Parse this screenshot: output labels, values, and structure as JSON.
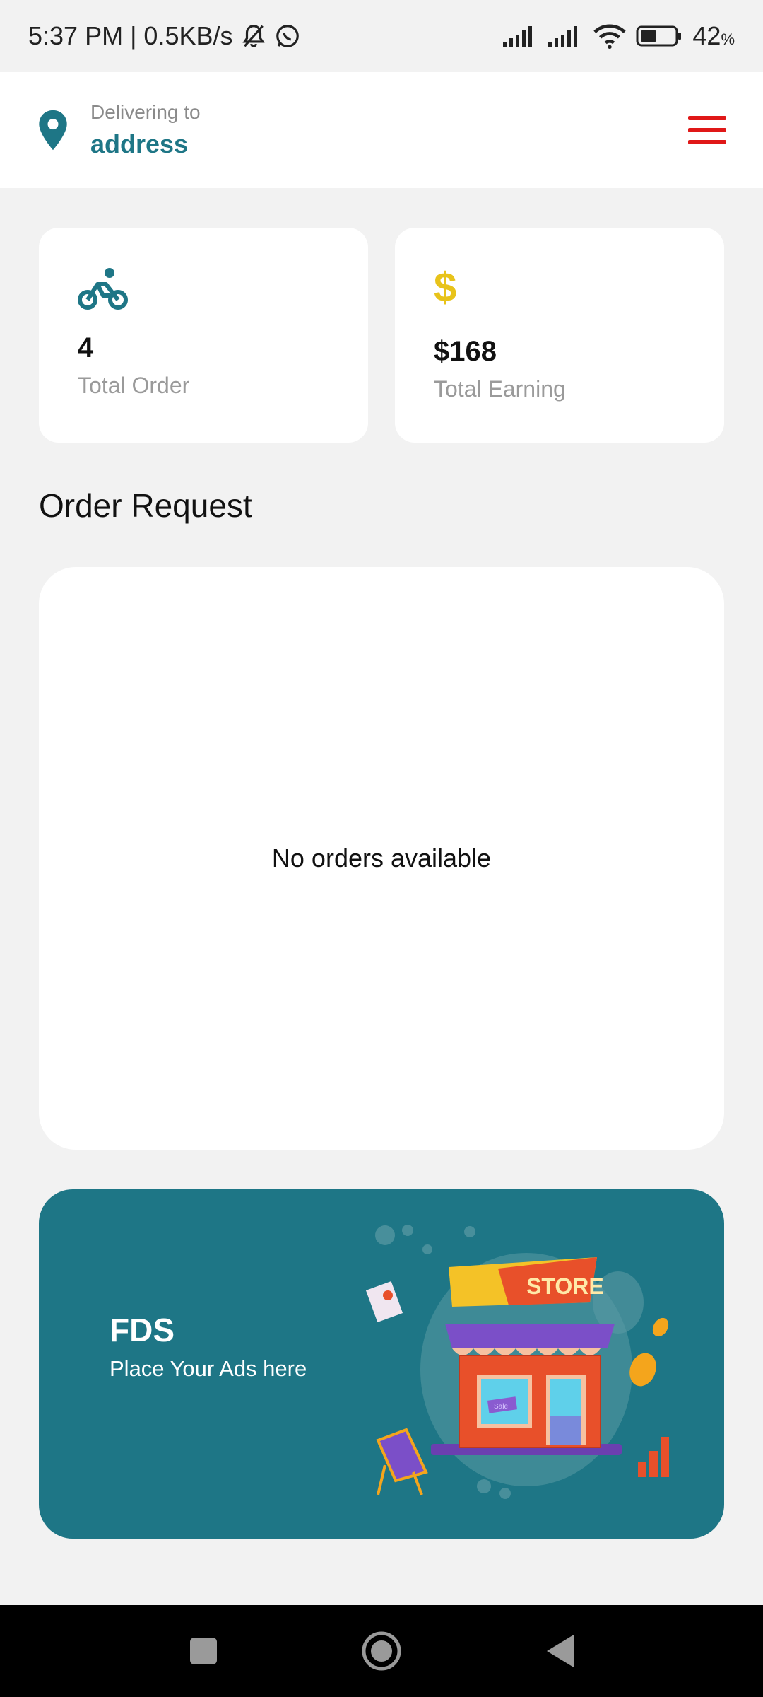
{
  "status_bar": {
    "time_net": "5:37 PM | 0.5KB/s",
    "battery": "42",
    "battery_unit": "%",
    "icons": [
      "mute-bell-icon",
      "whatsapp-icon",
      "signal-icon",
      "signal-icon",
      "wifi-icon",
      "battery-icon"
    ]
  },
  "header": {
    "deliver_label": "Delivering to",
    "address": "address",
    "icons": [
      "location-pin-icon",
      "hamburger-menu-icon"
    ]
  },
  "stats": [
    {
      "icon": "bicycle-icon",
      "value": "4",
      "label": "Total Order"
    },
    {
      "icon": "dollar-icon",
      "value": "$168",
      "label": "Total Earning",
      "glyph": "$"
    }
  ],
  "orders": {
    "title": "Order Request",
    "empty_text": "No orders available"
  },
  "ad": {
    "title": "FDS",
    "subtitle": "Place Your Ads here",
    "store_sign": "STORE",
    "window_sign": "Sale"
  },
  "colors": {
    "accent": "#1e7686",
    "menu_red": "#e01818",
    "dollar_yellow": "#e8c31a",
    "background": "#f2f2f2"
  },
  "nav": {
    "icons": [
      "recent-apps-icon",
      "home-icon",
      "back-icon"
    ]
  }
}
